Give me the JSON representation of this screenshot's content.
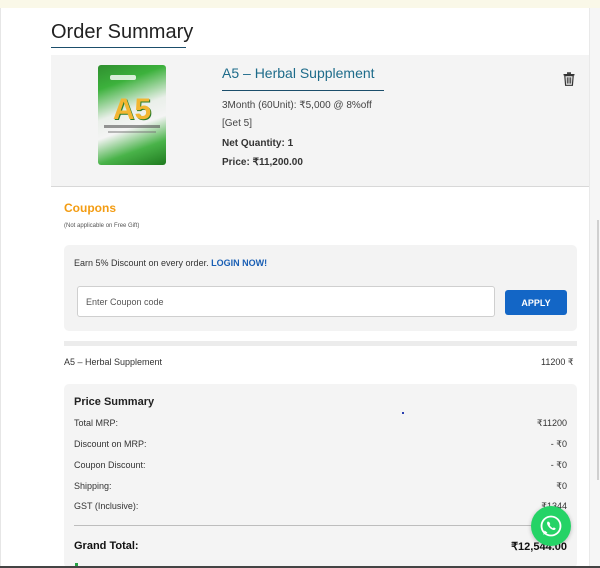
{
  "page": {
    "title": "Order Summary"
  },
  "product": {
    "name": "A5 – Herbal Supplement",
    "image_label": "A5",
    "variant": "3Month (60Unit): ₹5,000 @ 8%off",
    "offer": "[Get 5]",
    "net_quantity_label": "Net Quantity:",
    "net_quantity_value": "1",
    "price_label": "Price:",
    "price_value": "₹11,200.00",
    "delete_icon": "trash-icon"
  },
  "coupons": {
    "title": "Coupons",
    "note": "(Not applicable on Free Gift)",
    "earn_text": "Earn 5% Discount on every order.",
    "login_link": "LOGIN NOW!",
    "input_placeholder": "Enter Coupon code",
    "input_value": "",
    "apply_label": "APPLY"
  },
  "cart_line": {
    "name": "A5 – Herbal Supplement",
    "amount": "11200 ₹"
  },
  "price_summary": {
    "title": "Price Summary",
    "rows": [
      {
        "label": "Total MRP:",
        "value": "₹11200"
      },
      {
        "label": "Discount on MRP:",
        "value": "- ₹0"
      },
      {
        "label": "Coupon Discount:",
        "value": "- ₹0"
      },
      {
        "label": "Shipping:",
        "value": "₹0"
      },
      {
        "label": "GST (Inclusive):",
        "value": "₹1344"
      }
    ],
    "grand_total_label": "Grand Total:",
    "grand_total_value": "₹12,544.00"
  },
  "colors": {
    "accent_blue": "#1366c6",
    "coupon_orange": "#f39c12",
    "link_teal": "#1d6b8a",
    "whatsapp_green": "#25d366"
  }
}
